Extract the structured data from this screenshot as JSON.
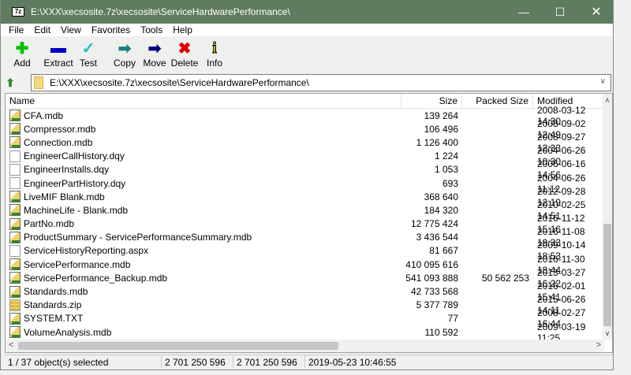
{
  "window": {
    "title": "E:\\XXX\\xecsosite.7z\\xecsosite\\ServiceHardwarePerformance\\",
    "app_icon": "7z",
    "title_bar_color": "#607c60"
  },
  "menu": [
    "File",
    "Edit",
    "View",
    "Favorites",
    "Tools",
    "Help"
  ],
  "toolbar": [
    {
      "label": "Add",
      "icon": "plus-icon",
      "color": "#00c000"
    },
    {
      "label": "Extract",
      "icon": "minus-icon",
      "color": "#0000c0"
    },
    {
      "label": "Test",
      "icon": "check-icon",
      "color": "#20c0c0"
    },
    {
      "label": "Copy",
      "icon": "copy-arrow-icon",
      "color": "#208080"
    },
    {
      "label": "Move",
      "icon": "move-arrow-icon",
      "color": "#000080"
    },
    {
      "label": "Delete",
      "icon": "delete-x-icon",
      "color": "#e00000"
    },
    {
      "label": "Info",
      "icon": "info-icon",
      "color": "#e0c000"
    }
  ],
  "address": {
    "path": "E:\\XXX\\xecsosite.7z\\xecsosite\\ServiceHardwarePerformance\\"
  },
  "columns": {
    "name": "Name",
    "size": "Size",
    "packed": "Packed Size",
    "modified": "Modified"
  },
  "files": [
    {
      "name": "CFA.mdb",
      "type": "mdb",
      "size": "139 264",
      "packed": "",
      "modified": "2008-03-12 14:30"
    },
    {
      "name": "Compressor.mdb",
      "type": "mdb",
      "size": "106 496",
      "packed": "",
      "modified": "2008-09-02 12:49"
    },
    {
      "name": "Connection.mdb",
      "type": "mdb",
      "size": "1 126 400",
      "packed": "",
      "modified": "2008-09-27 12:33"
    },
    {
      "name": "EngineerCallHistory.dqy",
      "type": "file",
      "size": "1 224",
      "packed": "",
      "modified": "2004-06-26 10:30"
    },
    {
      "name": "EngineerInstalls.dqy",
      "type": "file",
      "size": "1 053",
      "packed": "",
      "modified": "2006-06-16 14:56"
    },
    {
      "name": "EngineerPartHistory.dqy",
      "type": "file",
      "size": "693",
      "packed": "",
      "modified": "2004-06-26 11:12"
    },
    {
      "name": "LiveMIF Blank.mdb",
      "type": "mdb",
      "size": "368 640",
      "packed": "",
      "modified": "2012-09-28 12:19"
    },
    {
      "name": "MachineLife - Blank.mdb",
      "type": "mdb",
      "size": "184 320",
      "packed": "",
      "modified": "2010-02-25 14:51"
    },
    {
      "name": "PartNo.mdb",
      "type": "mdb",
      "size": "12 775 424",
      "packed": "",
      "modified": "2016-11-12 15:16"
    },
    {
      "name": "ProductSummary - ServicePerformanceSummary.mdb",
      "type": "mdb",
      "size": "3 436 544",
      "packed": "",
      "modified": "2016-11-08 19:33"
    },
    {
      "name": "ServiceHistoryReporting.aspx",
      "type": "file",
      "size": "81 667",
      "packed": "",
      "modified": "2009-10-14 18:53"
    },
    {
      "name": "ServicePerformance.mdb",
      "type": "mdb",
      "size": "410 095 616",
      "packed": "",
      "modified": "2016-11-30 18:44"
    },
    {
      "name": "ServicePerformance_Backup.mdb",
      "type": "mdb",
      "size": "541 093 888",
      "packed": "50 562 253",
      "modified": "2013-03-27 16:22"
    },
    {
      "name": "Standards.mdb",
      "type": "mdb",
      "size": "42 733 568",
      "packed": "",
      "modified": "2016-02-01 15:41"
    },
    {
      "name": "Standards.zip",
      "type": "zip",
      "size": "5 377 789",
      "packed": "",
      "modified": "2015-06-26 14:11"
    },
    {
      "name": "SYSTEM.TXT",
      "type": "mdb",
      "size": "77",
      "packed": "",
      "modified": "2008-02-27 16:44"
    },
    {
      "name": "VolumeAnalysis.mdb",
      "type": "mdb",
      "size": "110 592",
      "packed": "",
      "modified": "2009-03-19 11:25"
    }
  ],
  "status": {
    "selected": "1 / 37 object(s) selected",
    "size": "2 701 250 596",
    "packed": "2 701 250 596",
    "modified": "2019-05-23 10:46:55"
  }
}
